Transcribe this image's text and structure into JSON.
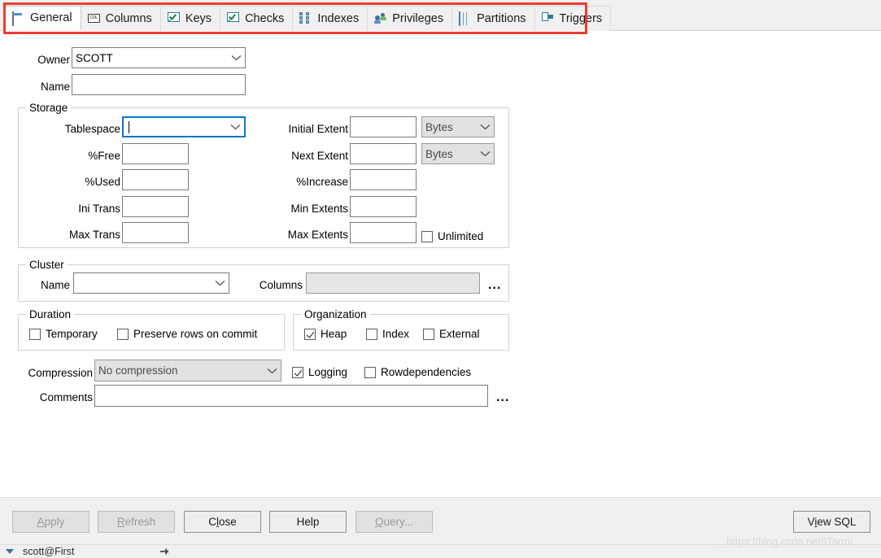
{
  "tabs": [
    {
      "label": "General",
      "icon": "general-form-icon",
      "active": true
    },
    {
      "label": "Columns",
      "icon": "column-icon",
      "active": false
    },
    {
      "label": "Keys",
      "icon": "key-check-icon",
      "active": false
    },
    {
      "label": "Checks",
      "icon": "check-constraint-icon",
      "active": false
    },
    {
      "label": "Indexes",
      "icon": "indexes-icon",
      "active": false
    },
    {
      "label": "Privileges",
      "icon": "privileges-people-icon",
      "active": false
    },
    {
      "label": "Partitions",
      "icon": "partitions-grid-icon",
      "active": false
    },
    {
      "label": "Triggers",
      "icon": "trigger-icon",
      "active": false
    }
  ],
  "annotation": {
    "color": "#ee3b33",
    "shape": "rectangle"
  },
  "form": {
    "owner": {
      "label": "Owner",
      "value": "SCOTT"
    },
    "name": {
      "label": "Name",
      "value": ""
    },
    "storage": {
      "title": "Storage",
      "tablespace": {
        "label": "Tablespace",
        "value": "",
        "focused": true
      },
      "pct_free": {
        "label": "%Free",
        "value": ""
      },
      "pct_used": {
        "label": "%Used",
        "value": ""
      },
      "ini_trans": {
        "label": "Ini Trans",
        "value": ""
      },
      "max_trans": {
        "label": "Max Trans",
        "value": ""
      },
      "initial_extent": {
        "label": "Initial Extent",
        "value": "",
        "unit": "Bytes",
        "unit_disabled": true
      },
      "next_extent": {
        "label": "Next Extent",
        "value": "",
        "unit": "Bytes",
        "unit_disabled": true
      },
      "pct_increase": {
        "label": "%Increase",
        "value": ""
      },
      "min_extents": {
        "label": "Min Extents",
        "value": ""
      },
      "max_extents": {
        "label": "Max Extents",
        "value": ""
      },
      "unlimited": {
        "label": "Unlimited",
        "checked": false
      }
    },
    "cluster": {
      "title": "Cluster",
      "name": {
        "label": "Name",
        "value": ""
      },
      "columns": {
        "label": "Columns",
        "value": "",
        "disabled": true
      },
      "browse": {
        "label": "..."
      }
    },
    "duration": {
      "title": "Duration",
      "temporary": {
        "label": "Temporary",
        "checked": false
      },
      "preserve": {
        "label": "Preserve rows on commit",
        "checked": false
      }
    },
    "organization": {
      "title": "Organization",
      "heap": {
        "label": "Heap",
        "checked": true
      },
      "index": {
        "label": "Index",
        "checked": false
      },
      "external": {
        "label": "External",
        "checked": false
      }
    },
    "compression": {
      "label": "Compression",
      "value": "No compression",
      "disabled": true
    },
    "logging": {
      "label": "Logging",
      "checked": true
    },
    "rowdependencies": {
      "label": "Rowdependencies",
      "checked": false
    },
    "comments": {
      "label": "Comments",
      "value": "",
      "browse": "..."
    }
  },
  "buttons": {
    "apply": {
      "label": "Apply",
      "mnemonic": "A",
      "disabled": true
    },
    "refresh": {
      "label": "Refresh",
      "mnemonic": "R",
      "disabled": true
    },
    "close": {
      "label": "Close",
      "mnemonic": "l",
      "disabled": false
    },
    "help": {
      "label": "Help",
      "mnemonic": "",
      "disabled": false
    },
    "query": {
      "label": "Query...",
      "mnemonic": "Q",
      "disabled": true
    },
    "view_sql": {
      "label": "View SQL",
      "mnemonic": "i",
      "disabled": false
    }
  },
  "statusbar": {
    "connection": "scott@First"
  },
  "watermark": {
    "text": "https://blog.csdn.net/ITarmi"
  }
}
